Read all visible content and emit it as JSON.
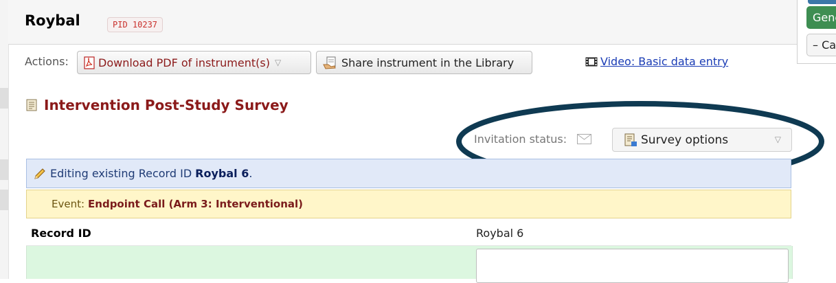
{
  "header": {
    "record_name": "Roybal",
    "pid_badge": "PID 10237"
  },
  "right_panel": {
    "gen_button_label": "Gene",
    "cancel_button_label": "– Ca"
  },
  "actions": {
    "label": "Actions:",
    "download_pdf_label": "Download PDF of instrument(s)",
    "share_label": "Share instrument in the Library",
    "video_link_label": "Video: Basic data entry"
  },
  "survey": {
    "title": "Intervention Post-Study Survey",
    "invitation_label": "Invitation status:",
    "survey_options_label": "Survey options"
  },
  "editing_bar": {
    "prefix": "Editing existing Record ID",
    "record": "Roybal 6",
    "suffix": "."
  },
  "event_bar": {
    "prefix": "Event:",
    "event_name": "Endpoint Call (Arm 3: Interventional)"
  },
  "record_row": {
    "label": "Record ID",
    "value": "Roybal 6"
  },
  "colors": {
    "title_red": "#8b1a1a",
    "link_blue": "#1a3cb5",
    "highlight_oval": "#0f3a52",
    "edit_bar_bg": "#e1e9f8",
    "event_bar_bg": "#fff6c9",
    "field_green": "#dcf7e0"
  },
  "icons": [
    "pdf-icon",
    "share-icon",
    "film-icon",
    "form-icon",
    "envelope-icon",
    "survey-options-icon",
    "pencil-icon",
    "caret-down-icon"
  ]
}
